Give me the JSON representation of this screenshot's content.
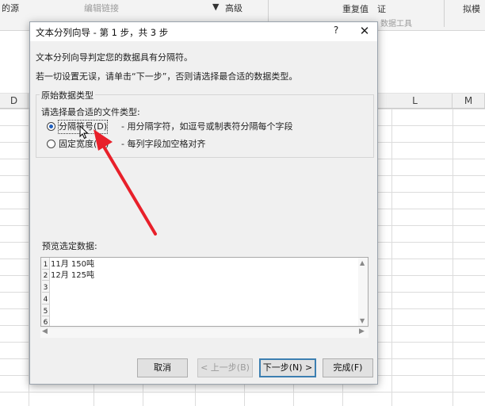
{
  "ribbon": {
    "items": [
      {
        "label": "的源",
        "dim": false
      },
      {
        "label": "编辑链接",
        "dim": true
      },
      {
        "label": "高级",
        "dim": false
      },
      {
        "label": "重复值",
        "dim": false
      },
      {
        "label": "证",
        "dim": false
      },
      {
        "label": "数据工具",
        "dim": true
      },
      {
        "label": "拟模",
        "dim": false
      }
    ]
  },
  "columns": {
    "left": "D",
    "right1": "L",
    "right2": "M"
  },
  "dialog": {
    "title": "文本分列向导 - 第 1 步，共 3 步",
    "help": "?",
    "close": "✕",
    "intro": "文本分列向导判定您的数据具有分隔符。",
    "hint": "若一切设置无误，请单击“下一步”，否则请选择最合适的数据类型。",
    "group_legend": "原始数据类型",
    "group_sub": "请选择最合适的文件类型:",
    "option_delimited": {
      "label": "分隔符号(D)",
      "desc": "- 用分隔字符，如逗号或制表符分隔每个字段",
      "checked": true
    },
    "option_fixed": {
      "label": "固定宽度(W)",
      "desc": "- 每列字段加空格对齐",
      "checked": false
    },
    "preview_label": "预览选定数据:",
    "preview_rows": [
      "1",
      "2",
      "3",
      "4",
      "5",
      "6"
    ],
    "preview_lines": [
      "11月 150吨",
      "12月 125吨"
    ],
    "buttons": {
      "cancel": "取消",
      "back": "< 上一步(B)",
      "next": "下一步(N) >",
      "finish": "完成(F)"
    }
  },
  "colors": {
    "radio_selected": "#1f5fbf",
    "annotation_arrow": "#e8202a",
    "default_button_border": "#3c7fb1"
  }
}
